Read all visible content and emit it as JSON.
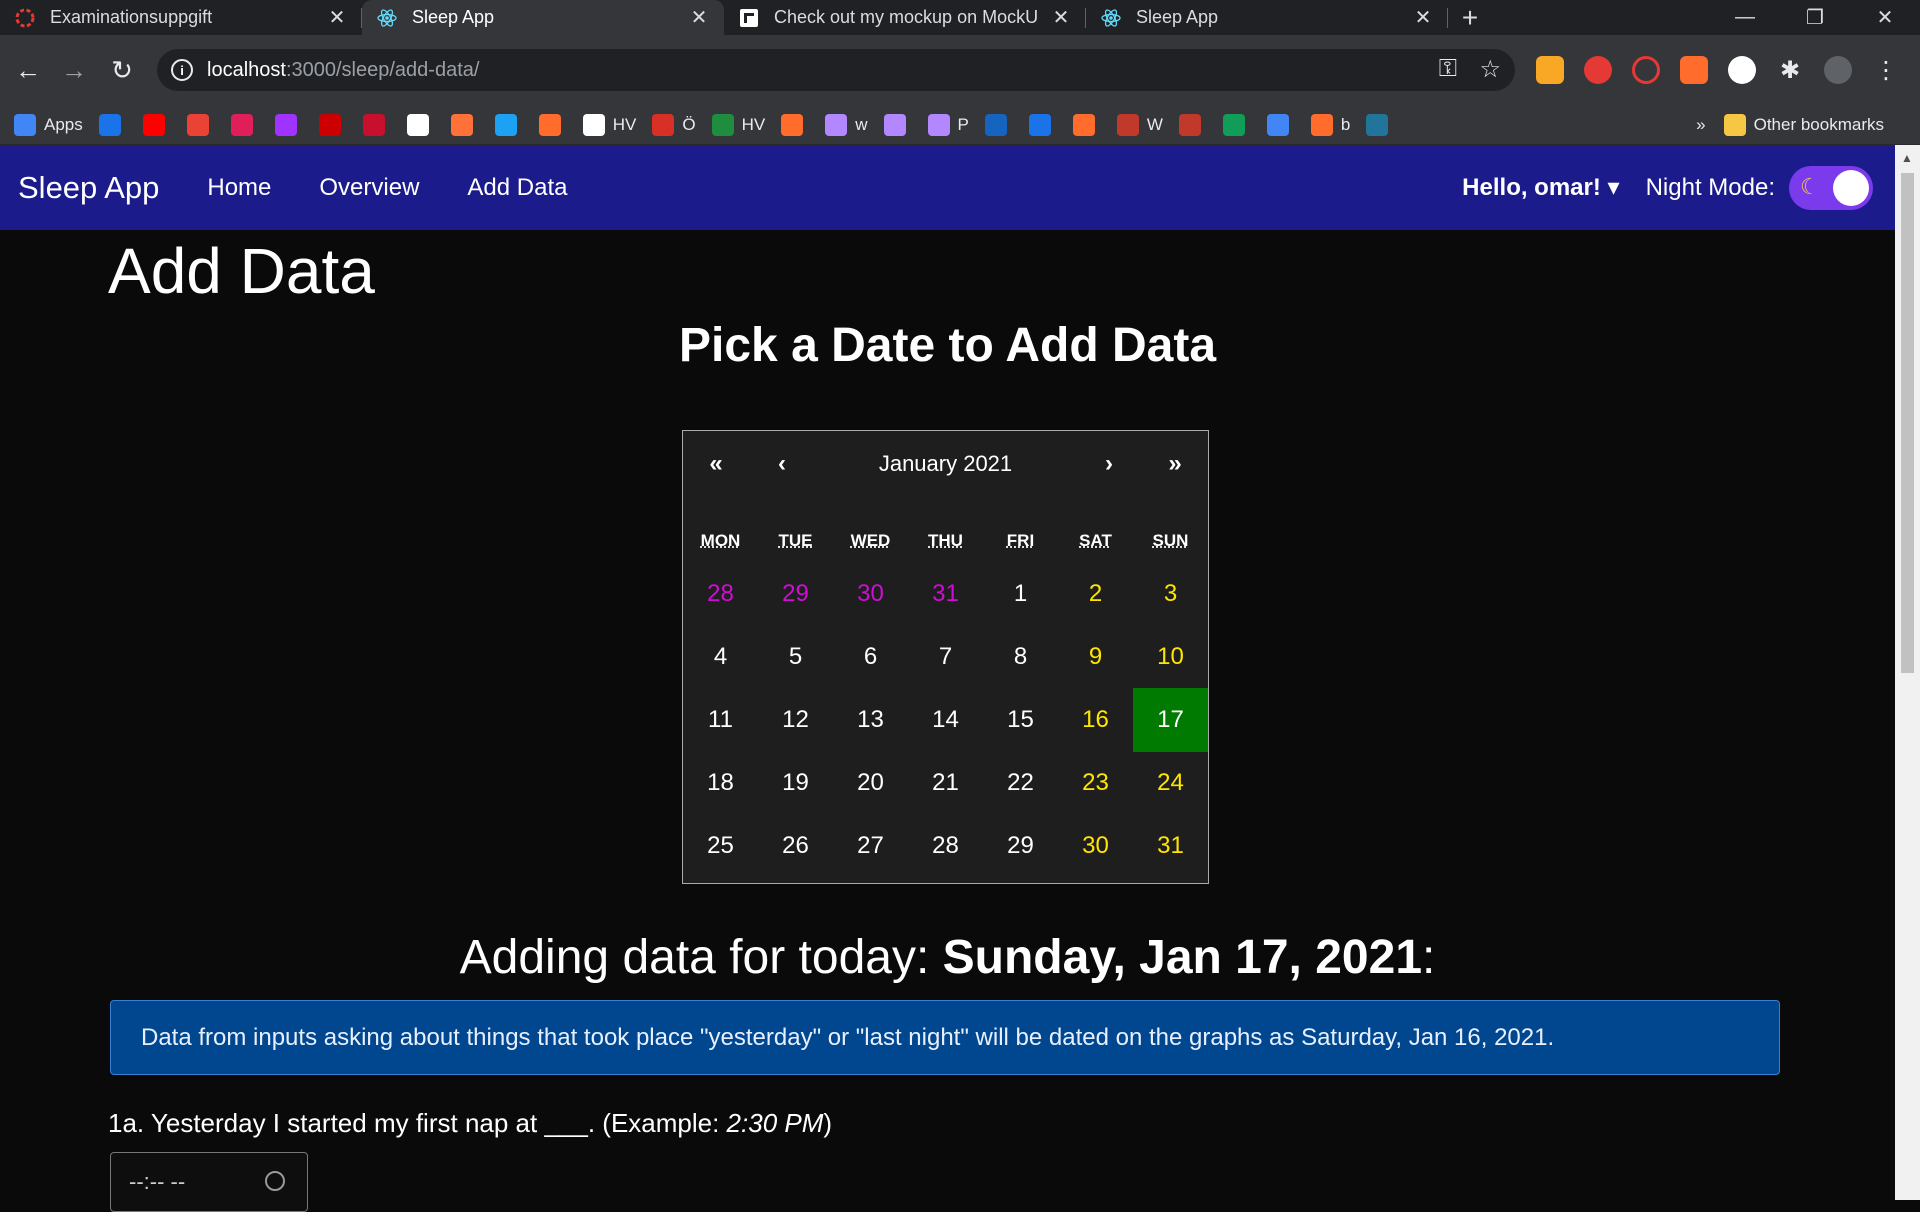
{
  "browser": {
    "tabs": [
      {
        "title": "Examinationsuppgift",
        "icon": "red-ring-icon",
        "active": false
      },
      {
        "title": "Sleep App",
        "icon": "react-icon",
        "active": true
      },
      {
        "title": "Check out my mockup on MockU",
        "icon": "mockup-icon",
        "active": false
      },
      {
        "title": "Sleep App",
        "icon": "react-icon",
        "active": false
      }
    ],
    "new_tab": "+",
    "window_controls": {
      "minimize": "—",
      "restore": "❐",
      "close": "✕"
    },
    "nav": {
      "back": "←",
      "forward": "→",
      "reload": "↻"
    },
    "url": {
      "host": "localhost",
      "path": ":3000/sleep/add-data/"
    },
    "bookmarks": [
      {
        "label": "Apps",
        "color": "#4285f4"
      },
      {
        "label": "",
        "color": "#1a73e8"
      },
      {
        "label": "",
        "color": "#ff0000"
      },
      {
        "label": "",
        "color": "#ea4335"
      },
      {
        "label": "",
        "color": "#e01e5a"
      },
      {
        "label": "",
        "color": "#a033ff"
      },
      {
        "label": "",
        "color": "#cc0000"
      },
      {
        "label": "",
        "color": "#c8102e"
      },
      {
        "label": "",
        "color": "#ffffff"
      },
      {
        "label": "",
        "color": "#ff7139"
      },
      {
        "label": "",
        "color": "#1da1f2"
      },
      {
        "label": "",
        "color": "#ff6c2c"
      },
      {
        "label": "HV",
        "color": "#ffffff"
      },
      {
        "label": "Ö",
        "color": "#d93025"
      },
      {
        "label": "HV",
        "color": "#1e8e3e"
      },
      {
        "label": "",
        "color": "#ff6c2c"
      },
      {
        "label": "w",
        "color": "#b388ff"
      },
      {
        "label": "",
        "color": "#b388ff"
      },
      {
        "label": "P",
        "color": "#b388ff"
      },
      {
        "label": "",
        "color": "#1565c0"
      },
      {
        "label": "",
        "color": "#1a73e8"
      },
      {
        "label": "",
        "color": "#ff6c2c"
      },
      {
        "label": "W",
        "color": "#c0392b"
      },
      {
        "label": "",
        "color": "#c0392b"
      },
      {
        "label": "",
        "color": "#0f9d58"
      },
      {
        "label": "",
        "color": "#4285f4"
      },
      {
        "label": "b",
        "color": "#ff6c2c"
      },
      {
        "label": "",
        "color": "#21759b"
      }
    ],
    "bookmarks_more": "»",
    "other_bookmarks": "Other bookmarks"
  },
  "app": {
    "brand": "Sleep App",
    "nav_links": [
      "Home",
      "Overview",
      "Add Data"
    ],
    "user_greeting": "Hello, omar!",
    "dropdown_caret": "▾",
    "night_mode_label": "Night Mode:",
    "night_mode_on": true
  },
  "page": {
    "title": "Add Data",
    "subtitle": "Pick a Date to Add Data",
    "adding_prefix": "Adding data for today: ",
    "adding_date": "Sunday, Jan 17, 2021",
    "adding_suffix": ":",
    "alert": "Data from inputs asking about things that took place \"yesterday\" or \"last night\" will be dated on the graphs as Saturday, Jan 16, 2021.",
    "question_1a_text": "1a. Yesterday I started my first nap at ___. (Example: ",
    "question_1a_example": "2:30 PM",
    "question_1a_end": ")",
    "time_placeholder": "--:-- --"
  },
  "calendar": {
    "month_label": "January 2021",
    "nav": {
      "prev_year": "«",
      "prev_month": "‹",
      "next_month": "›",
      "next_year": "»"
    },
    "weekdays": [
      "MON",
      "TUE",
      "WED",
      "THU",
      "FRI",
      "SAT",
      "SUN"
    ],
    "days": [
      {
        "d": "28",
        "t": "prev"
      },
      {
        "d": "29",
        "t": "prev"
      },
      {
        "d": "30",
        "t": "prev"
      },
      {
        "d": "31",
        "t": "prev"
      },
      {
        "d": "1",
        "t": ""
      },
      {
        "d": "2",
        "t": "weekend"
      },
      {
        "d": "3",
        "t": "weekend"
      },
      {
        "d": "4",
        "t": ""
      },
      {
        "d": "5",
        "t": ""
      },
      {
        "d": "6",
        "t": ""
      },
      {
        "d": "7",
        "t": ""
      },
      {
        "d": "8",
        "t": ""
      },
      {
        "d": "9",
        "t": "weekend"
      },
      {
        "d": "10",
        "t": "weekend"
      },
      {
        "d": "11",
        "t": ""
      },
      {
        "d": "12",
        "t": ""
      },
      {
        "d": "13",
        "t": ""
      },
      {
        "d": "14",
        "t": ""
      },
      {
        "d": "15",
        "t": ""
      },
      {
        "d": "16",
        "t": "weekend"
      },
      {
        "d": "17",
        "t": "selected"
      },
      {
        "d": "18",
        "t": ""
      },
      {
        "d": "19",
        "t": ""
      },
      {
        "d": "20",
        "t": ""
      },
      {
        "d": "21",
        "t": ""
      },
      {
        "d": "22",
        "t": ""
      },
      {
        "d": "23",
        "t": "weekend"
      },
      {
        "d": "24",
        "t": "weekend"
      },
      {
        "d": "25",
        "t": ""
      },
      {
        "d": "26",
        "t": ""
      },
      {
        "d": "27",
        "t": ""
      },
      {
        "d": "28",
        "t": ""
      },
      {
        "d": "29",
        "t": ""
      },
      {
        "d": "30",
        "t": "weekend"
      },
      {
        "d": "31",
        "t": "weekend"
      }
    ],
    "colors": {
      "prev_month": "#d20bd8",
      "weekend": "#ffe500",
      "selected_bg": "#007a00"
    }
  }
}
